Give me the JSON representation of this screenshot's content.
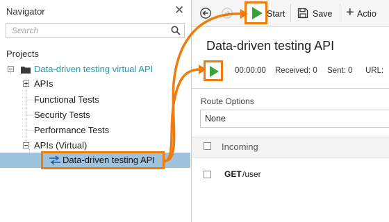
{
  "navigator": {
    "title": "Navigator",
    "close_glyph": "✕",
    "search": {
      "placeholder": "Search"
    },
    "projects_label": "Projects",
    "tree": {
      "project": "Data-driven testing virtual API",
      "apis": "APIs",
      "functional_tests": "Functional Tests",
      "security_tests": "Security Tests",
      "performance_tests": "Performance Tests",
      "apis_virtual": "APIs (Virtual)",
      "virtual_api": "Data-driven testing API"
    }
  },
  "toolbar": {
    "start_label": "Start",
    "save_label": "Save",
    "action_label": "Actio",
    "add_glyph": "+"
  },
  "editor": {
    "title": "Data-driven testing API",
    "time": "00:00:00",
    "received": "Received: 0",
    "sent": "Sent: 0",
    "url": "URL:",
    "route_options_label": "Route Options",
    "route_option_value": "None",
    "incoming_header": "Incoming",
    "rows": [
      {
        "method": "GET",
        "path": "/user"
      }
    ]
  },
  "icons": {
    "navigator_close": "close-icon",
    "search": "search-icon",
    "back": "back-arrow-icon",
    "forward": "forward-arrow-icon",
    "start": "play-icon",
    "save": "floppy-disk-icon",
    "add": "plus-icon",
    "folder": "folder-icon",
    "virtual_api": "route-arrows-icon"
  },
  "colors": {
    "highlight_orange": "#ef7d0d",
    "play_green": "#3aa335",
    "project_teal": "#1e9bb3",
    "selection_blue": "#9fc3dc"
  }
}
